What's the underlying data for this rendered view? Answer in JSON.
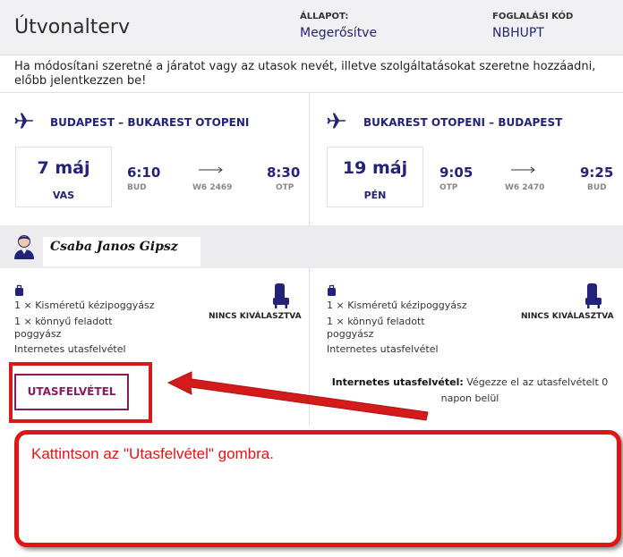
{
  "header": {
    "title": "Útvonalterv",
    "status_label": "ÁLLAPOT:",
    "status_value": "Megerősítve",
    "booking_code_label": "FOGLALÁSI KÓD",
    "booking_code_value": "NBHUPT"
  },
  "notice": "Ha módosítani szeretné a járatot vagy az utasok nevét, illetve szolgáltatásokat szeretne hozzáadni, előbb jelentkezzen be!",
  "flights": [
    {
      "route": "BUDAPEST – BUKAREST OTOPENI",
      "date": "7 máj",
      "weekday": "VAS",
      "dep_time": "6:10",
      "dep_airport": "BUD",
      "flight_no": "W6 2469",
      "arr_time": "8:30",
      "arr_airport": "OTP",
      "icon": "plane-icon"
    },
    {
      "route": "BUKAREST OTOPENI – BUDAPEST",
      "date": "19 máj",
      "weekday": "PÉN",
      "dep_time": "9:05",
      "dep_airport": "OTP",
      "flight_no": "W6 2470",
      "arr_time": "9:25",
      "arr_airport": "BUD",
      "icon": "plane-icon"
    }
  ],
  "passenger": {
    "name": "Csaba Janos Gipsz",
    "icon": "avatar-icon"
  },
  "services": [
    {
      "cabin_bag": "1 × Kisméretű kézipoggyász",
      "light_bag_line1": "1 × könnyű feladott",
      "light_bag_line2": "poggyász",
      "online_checkin": "Internetes utasfelvétel",
      "seat": "NINCS KIVÁLASZTVA"
    },
    {
      "cabin_bag": "1 × Kisméretű kézipoggyász",
      "light_bag_line1": "1 × könnyű feladott",
      "light_bag_line2": "poggyász",
      "online_checkin": "Internetes utasfelvétel",
      "seat": "NINCS KIVÁLASZTVA"
    }
  ],
  "checkin_button": "UTASFELVÉTEL",
  "checkin_info": {
    "label": "Internetes utasfelvétel:",
    "text": "Végezze el az utasfelvételt 0 napon belül"
  },
  "callout": "Kattintson az \"Utasfelvétel\" gombra.",
  "colors": {
    "navy": "#23237a",
    "brand_magenta": "#8a1b5e",
    "annotation_red": "#e01515"
  }
}
